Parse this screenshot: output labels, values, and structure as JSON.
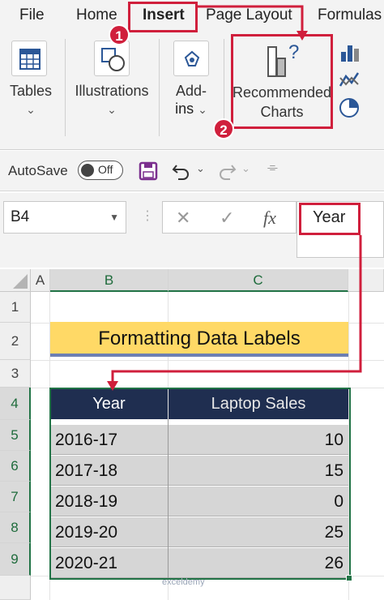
{
  "ribbon": {
    "tabs": [
      "File",
      "Home",
      "Insert",
      "Page Layout",
      "Formulas"
    ],
    "active_tab": "Insert",
    "groups": {
      "tables": "Tables",
      "illustrations": "Illustrations",
      "addins_line1": "Add-",
      "addins_line2": "ins",
      "recommended_line1": "Recommended",
      "recommended_line2": "Charts"
    }
  },
  "quick_access": {
    "autosave_label": "AutoSave",
    "autosave_state": "Off"
  },
  "formula_bar": {
    "name_box": "B4",
    "formula": "Year"
  },
  "sheet": {
    "columns": [
      "A",
      "B",
      "C"
    ],
    "rows": [
      "1",
      "2",
      "3",
      "4",
      "5",
      "6",
      "7",
      "8",
      "9"
    ],
    "title": "Formatting Data Labels",
    "table": {
      "headers": [
        "Year",
        "Laptop Sales"
      ],
      "rows": [
        [
          "2016-17",
          "10"
        ],
        [
          "2017-18",
          "15"
        ],
        [
          "2018-19",
          "0"
        ],
        [
          "2019-20",
          "25"
        ],
        [
          "2020-21",
          "26"
        ]
      ]
    }
  },
  "annotations": {
    "step1": "1",
    "step2": "2"
  },
  "colors": {
    "annotation_red": "#d01f3c",
    "header_navy": "#1f2e50",
    "title_fill": "#ffd966",
    "excel_green": "#217346"
  },
  "watermark": "exceldemy"
}
